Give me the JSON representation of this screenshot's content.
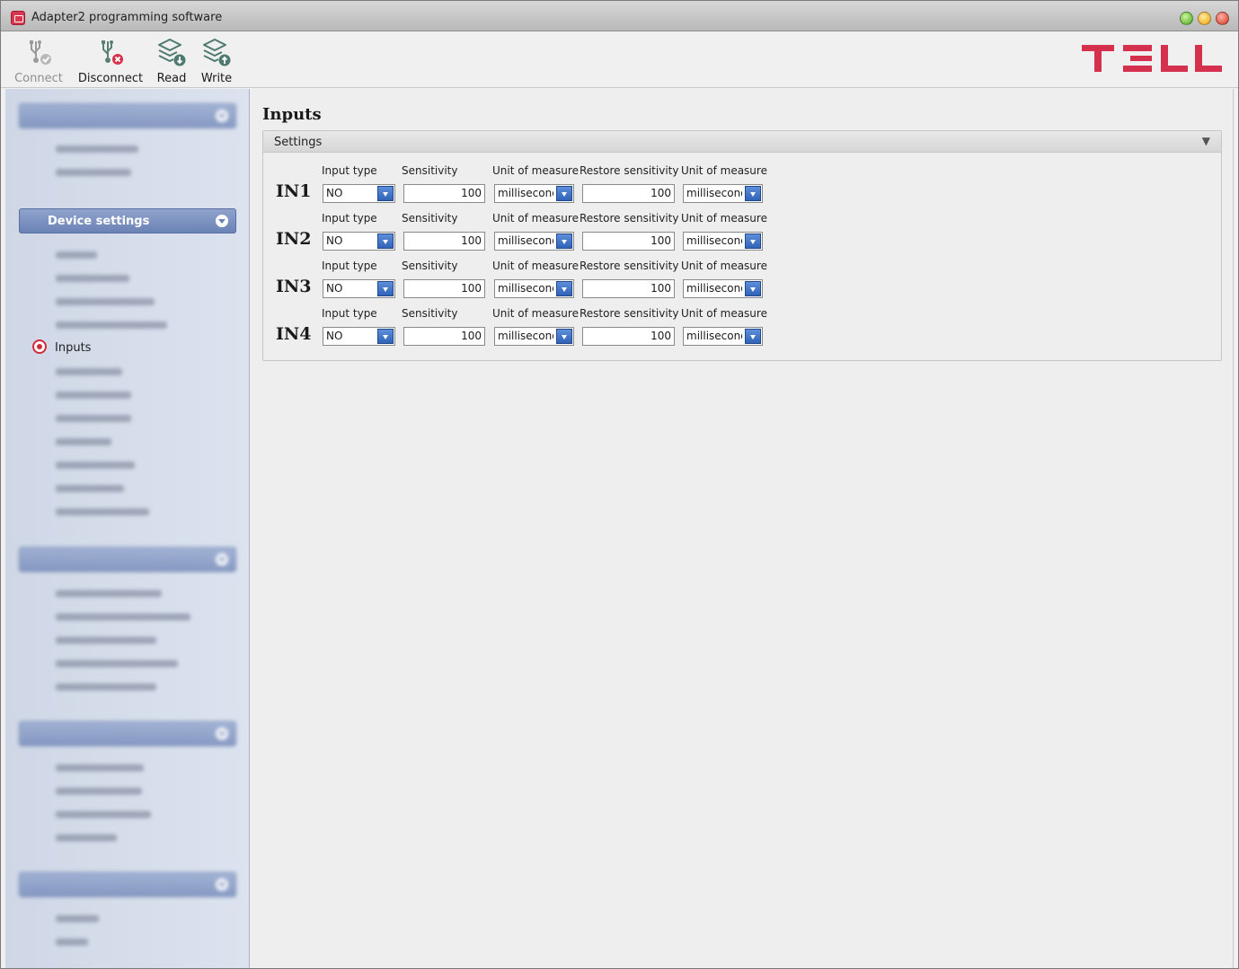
{
  "window": {
    "title": "Adapter2 programming software"
  },
  "toolbar": {
    "connect_label": "Connect",
    "disconnect_label": "Disconnect",
    "read_label": "Read",
    "write_label": "Write"
  },
  "brand": {
    "logo_text": "TELL",
    "accent_color": "#d6304f"
  },
  "sidebar": {
    "active_group_label": "Device settings",
    "active_item_label": "Inputs"
  },
  "main": {
    "page_title": "Inputs",
    "panel_title": "Settings",
    "collapse_glyph": "▼",
    "columns": {
      "input_type": "Input type",
      "sensitivity": "Sensitivity",
      "unit": "Unit of measure",
      "restore_sensitivity": "Restore sensitivity",
      "restore_unit": "Unit of measure"
    },
    "rows": [
      {
        "label": "IN1",
        "input_type": "NO",
        "sensitivity": "100",
        "unit": "milliseconds",
        "restore_sensitivity": "100",
        "restore_unit": "milliseconds"
      },
      {
        "label": "IN2",
        "input_type": "NO",
        "sensitivity": "100",
        "unit": "milliseconds",
        "restore_sensitivity": "100",
        "restore_unit": "milliseconds"
      },
      {
        "label": "IN3",
        "input_type": "NO",
        "sensitivity": "100",
        "unit": "milliseconds",
        "restore_sensitivity": "100",
        "restore_unit": "milliseconds"
      },
      {
        "label": "IN4",
        "input_type": "NO",
        "sensitivity": "100",
        "unit": "milliseconds",
        "restore_sensitivity": "100",
        "restore_unit": "milliseconds"
      }
    ]
  }
}
